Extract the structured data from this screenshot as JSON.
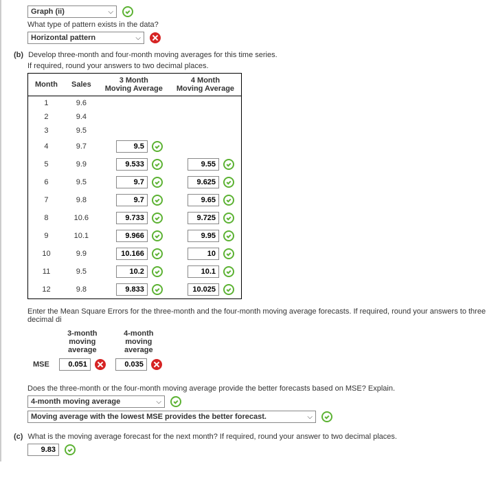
{
  "a": {
    "dropdown1": "Graph (ii)",
    "q2": "What type of pattern exists in the data?",
    "dropdown2": "Horizontal pattern"
  },
  "b": {
    "label": "(b)",
    "intro1": "Develop three-month and four-month moving averages for this time series.",
    "intro2": "If required, round your answers to two decimal places.",
    "headers": {
      "month": "Month",
      "sales": "Sales",
      "ma3": "3 Month\nMoving Average",
      "ma4": "4 Month\nMoving Average"
    },
    "rows": [
      {
        "m": "1",
        "s": "9.6",
        "a3": "",
        "a4": ""
      },
      {
        "m": "2",
        "s": "9.4",
        "a3": "",
        "a4": ""
      },
      {
        "m": "3",
        "s": "9.5",
        "a3": "",
        "a4": ""
      },
      {
        "m": "4",
        "s": "9.7",
        "a3": "9.5",
        "a4": ""
      },
      {
        "m": "5",
        "s": "9.9",
        "a3": "9.533",
        "a4": "9.55"
      },
      {
        "m": "6",
        "s": "9.5",
        "a3": "9.7",
        "a4": "9.625"
      },
      {
        "m": "7",
        "s": "9.8",
        "a3": "9.7",
        "a4": "9.65"
      },
      {
        "m": "8",
        "s": "10.6",
        "a3": "9.733",
        "a4": "9.725"
      },
      {
        "m": "9",
        "s": "10.1",
        "a3": "9.966",
        "a4": "9.95"
      },
      {
        "m": "10",
        "s": "9.9",
        "a3": "10.166",
        "a4": "10"
      },
      {
        "m": "11",
        "s": "9.5",
        "a3": "10.2",
        "a4": "10.1"
      },
      {
        "m": "12",
        "s": "9.8",
        "a3": "9.833",
        "a4": "10.025"
      }
    ],
    "mse_intro": "Enter the Mean Square Errors for the three-month and the four-month moving average forecasts. If required, round your answers to three decimal di",
    "mse_h3": "3-month\nmoving\naverage",
    "mse_h4": "4-month\nmoving\naverage",
    "mse_label": "MSE",
    "mse3": "0.051",
    "mse4": "0.035",
    "better_q": "Does the three-month or the four-month moving average provide the better forecasts based on MSE? Explain.",
    "better_dd1": "4-month moving average",
    "better_dd2": "Moving average with the lowest MSE provides the better forecast."
  },
  "c": {
    "label": "(c)",
    "q": "What is the moving average forecast for the next month? If required, round your answer to two decimal places.",
    "val": "9.83"
  }
}
